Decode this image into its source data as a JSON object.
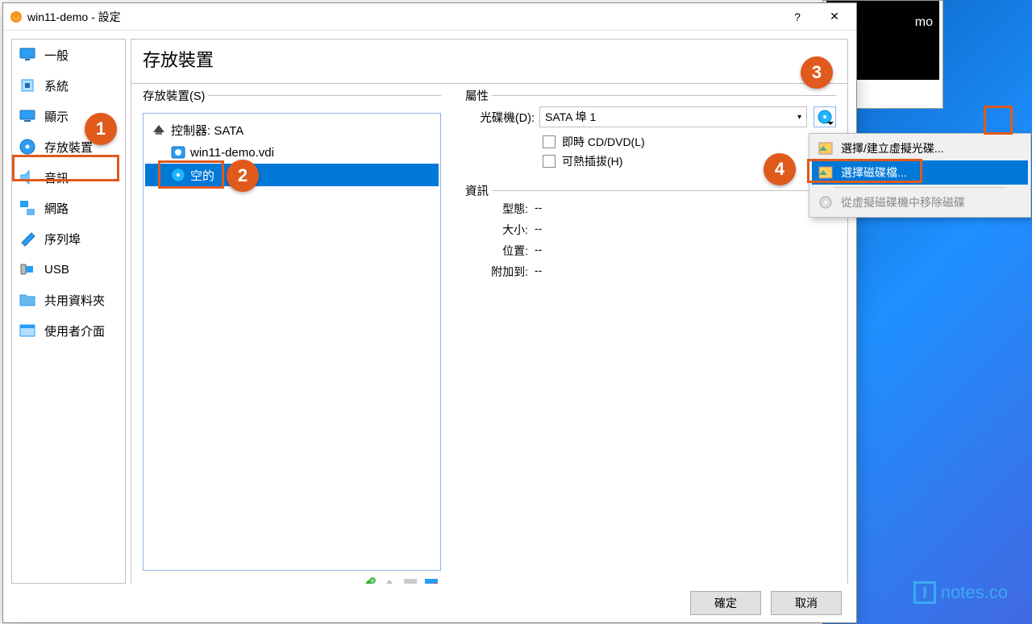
{
  "titlebar": {
    "title": "win11-demo - 設定",
    "help": "?",
    "close": "✕"
  },
  "sidebar": {
    "items": [
      {
        "label": "一般",
        "icon": "general"
      },
      {
        "label": "系統",
        "icon": "system"
      },
      {
        "label": "顯示",
        "icon": "display"
      },
      {
        "label": "存放裝置",
        "icon": "storage"
      },
      {
        "label": "音訊",
        "icon": "audio"
      },
      {
        "label": "網路",
        "icon": "network"
      },
      {
        "label": "序列埠",
        "icon": "serial"
      },
      {
        "label": "USB",
        "icon": "usb"
      },
      {
        "label": "共用資料夾",
        "icon": "folder"
      },
      {
        "label": "使用者介面",
        "icon": "ui"
      }
    ],
    "active_index": 3
  },
  "panel": {
    "heading": "存放裝置",
    "storage_group": "存放裝置(S)",
    "tree": {
      "controller": "控制器: SATA",
      "disk": "win11-demo.vdi",
      "optical": "空的"
    },
    "attr_group": "屬性",
    "attrs": {
      "drive_label": "光碟機(D):",
      "drive_value": "SATA 埠 1",
      "live_cd": "即時 CD/DVD(L)",
      "hotplug": "可熱插拔(H)"
    },
    "info_group": "資訊",
    "info": {
      "type_label": "型態:",
      "type_val": "--",
      "size_label": "大小:",
      "size_val": "--",
      "loc_label": "位置:",
      "loc_val": "--",
      "att_label": "附加到:",
      "att_val": "--"
    }
  },
  "context_menu": {
    "items": [
      {
        "label": "選擇/建立虛擬光碟...",
        "sel": false,
        "disabled": false
      },
      {
        "label": "選擇磁碟檔...",
        "sel": true,
        "disabled": false
      },
      {
        "label": "從虛擬磁碟機中移除磁碟",
        "sel": false,
        "disabled": true
      }
    ]
  },
  "footer": {
    "ok": "確定",
    "cancel": "取消"
  },
  "badges": [
    "1",
    "2",
    "3",
    "4"
  ],
  "vm_text": "mo"
}
